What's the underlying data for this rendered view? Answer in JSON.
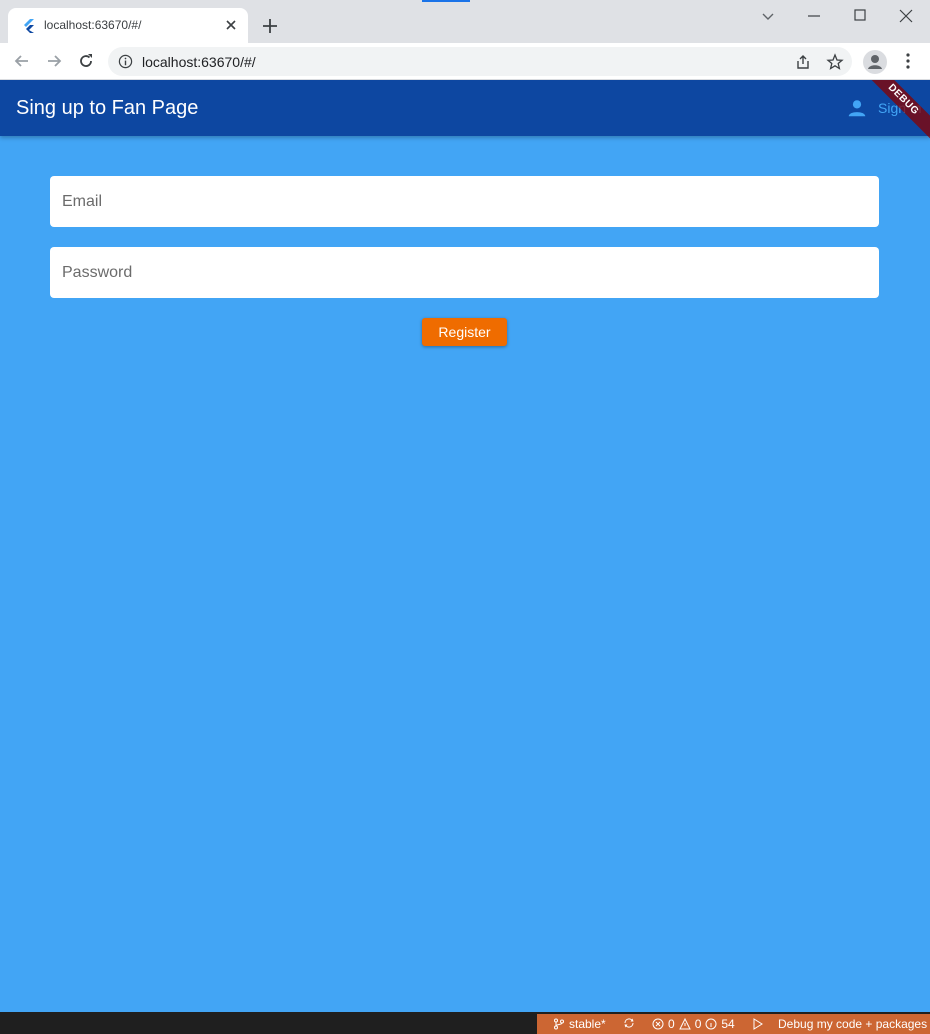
{
  "browser": {
    "tab_title": "localhost:63670/#/",
    "url": "localhost:63670/#/"
  },
  "app": {
    "title": "Sing up to Fan Page",
    "signin_label": "Sign In",
    "debug_banner": "DEBUG",
    "email_placeholder": "Email",
    "password_placeholder": "Password",
    "register_label": "Register",
    "colors": {
      "appbar": "#0d47a1",
      "background": "#42a5f5",
      "button": "#ef6c00"
    }
  },
  "statusbar": {
    "branch": "stable*",
    "errors": "0",
    "warnings": "0",
    "infos": "54",
    "debug_label": "Debug my code + packages"
  }
}
